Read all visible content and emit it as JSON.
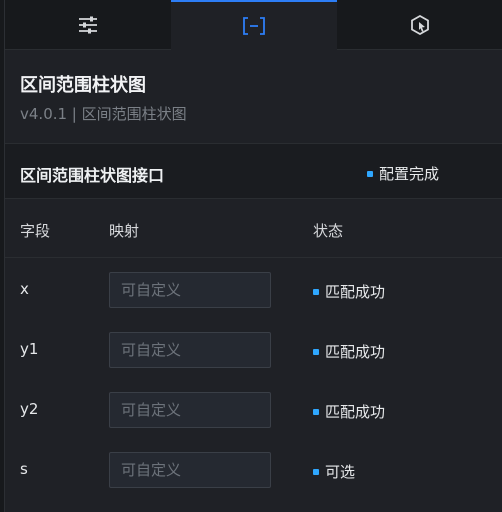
{
  "tabs": [
    {
      "name": "settings",
      "icon": "sliders-icon"
    },
    {
      "name": "data",
      "icon": "data-bracket-icon",
      "active": true
    },
    {
      "name": "interaction",
      "icon": "cursor-hex-icon"
    }
  ],
  "header": {
    "title": "区间范围柱状图",
    "version_line": "v4.0.1 | 区间范围柱状图"
  },
  "interface": {
    "title": "区间范围柱状图接口",
    "status": "配置完成"
  },
  "columns": {
    "field": "字段",
    "mapping": "映射",
    "status": "状态"
  },
  "rows": [
    {
      "field": "x",
      "placeholder": "可自定义",
      "status": "匹配成功"
    },
    {
      "field": "y1",
      "placeholder": "可自定义",
      "status": "匹配成功"
    },
    {
      "field": "y2",
      "placeholder": "可自定义",
      "status": "匹配成功"
    },
    {
      "field": "s",
      "placeholder": "可自定义",
      "status": "可选"
    }
  ],
  "colors": {
    "accent": "#2d7ef6",
    "status_dot": "#2fa7ff",
    "background": "#1f2126"
  }
}
